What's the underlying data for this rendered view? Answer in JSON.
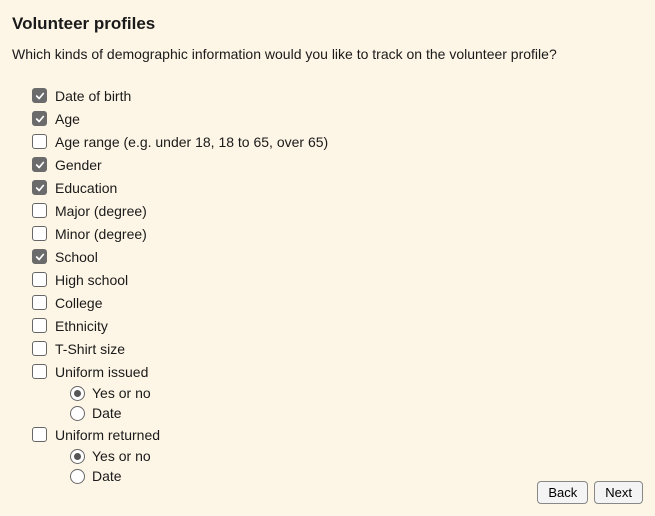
{
  "title": "Volunteer profiles",
  "prompt": "Which kinds of demographic information would you like to track on the volunteer profile?",
  "options": [
    {
      "label": "Date of birth",
      "checked": true
    },
    {
      "label": "Age",
      "checked": true
    },
    {
      "label": "Age range (e.g. under 18, 18 to 65, over 65)",
      "checked": false
    },
    {
      "label": "Gender",
      "checked": true
    },
    {
      "label": "Education",
      "checked": true
    },
    {
      "label": "Major (degree)",
      "checked": false
    },
    {
      "label": "Minor (degree)",
      "checked": false
    },
    {
      "label": "School",
      "checked": true
    },
    {
      "label": "High school",
      "checked": false
    },
    {
      "label": "College",
      "checked": false
    },
    {
      "label": "Ethnicity",
      "checked": false
    },
    {
      "label": "T-Shirt size",
      "checked": false
    },
    {
      "label": "Uniform issued",
      "checked": false,
      "sub": [
        {
          "label": "Yes or no",
          "selected": true
        },
        {
          "label": "Date",
          "selected": false
        }
      ]
    },
    {
      "label": "Uniform returned",
      "checked": false,
      "sub": [
        {
          "label": "Yes or no",
          "selected": true
        },
        {
          "label": "Date",
          "selected": false
        }
      ]
    }
  ],
  "buttons": {
    "back": "Back",
    "next": "Next"
  }
}
